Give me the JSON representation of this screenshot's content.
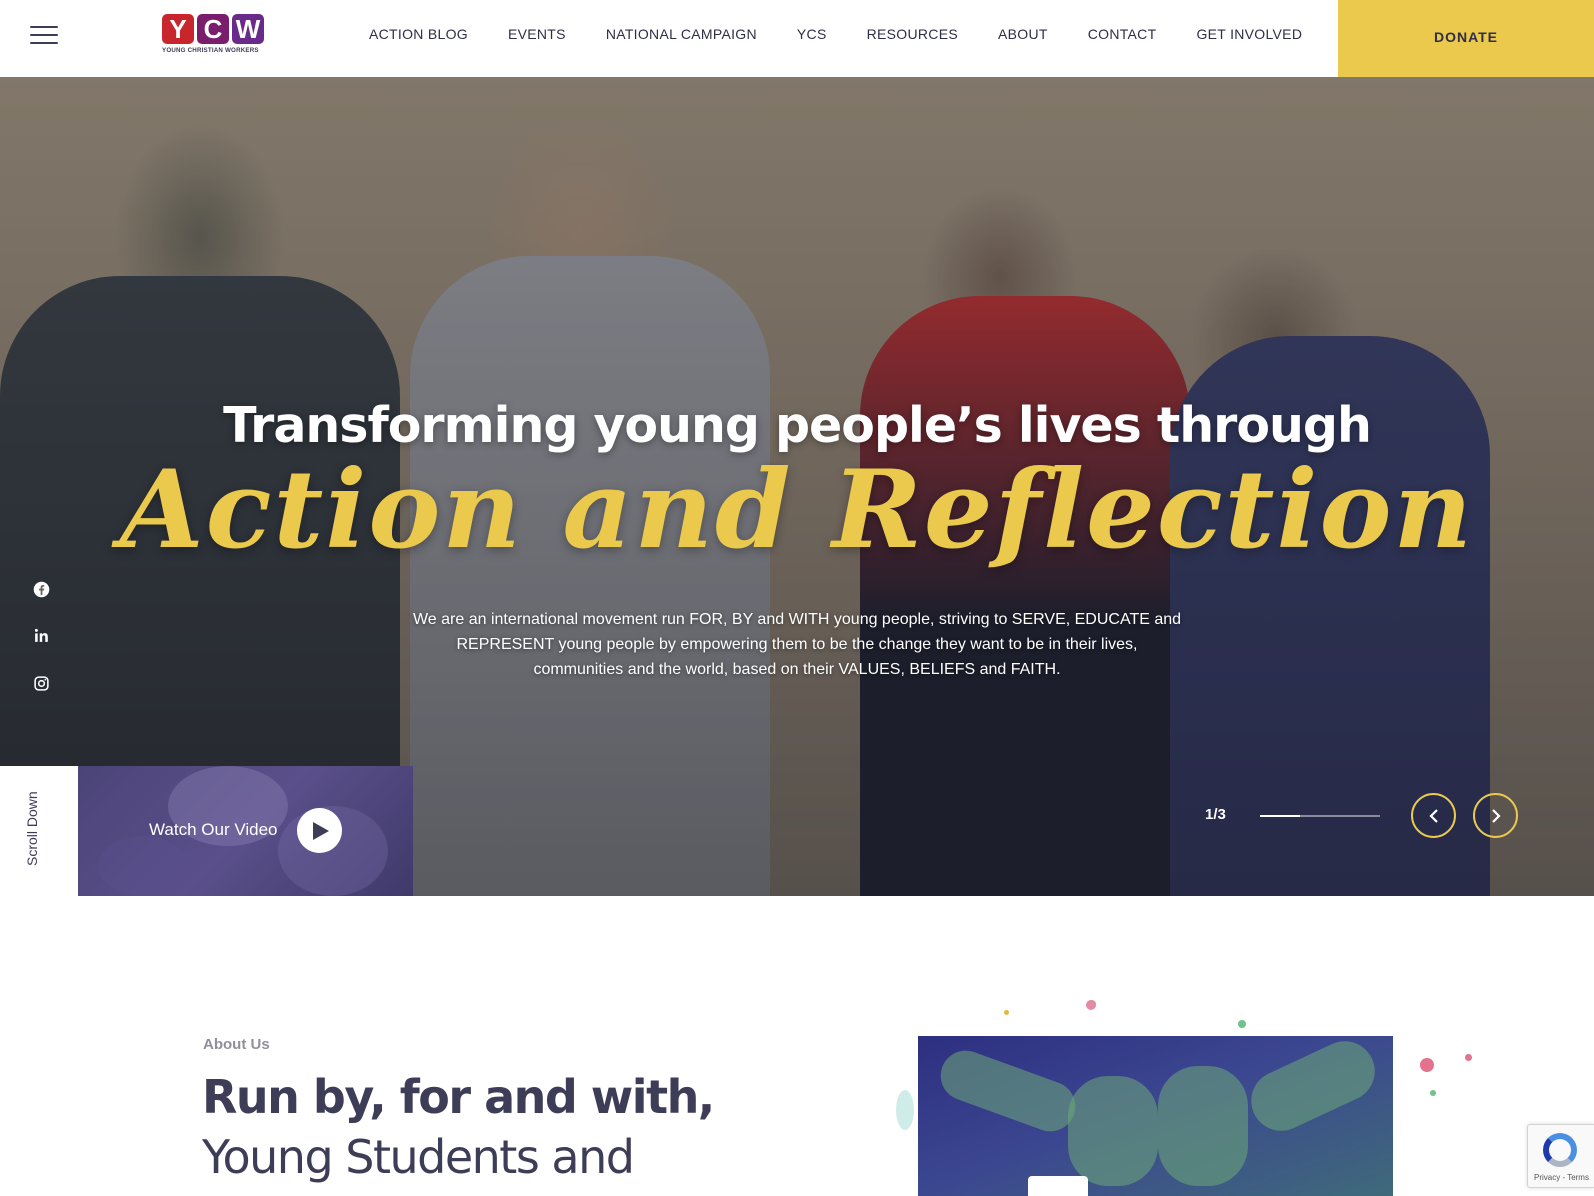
{
  "header": {
    "logo": {
      "letters": [
        "Y",
        "C",
        "W"
      ],
      "subtitle": "YOUNG CHRISTIAN WORKERS"
    },
    "nav": [
      {
        "label": "ACTION BLOG"
      },
      {
        "label": "EVENTS"
      },
      {
        "label": "NATIONAL CAMPAIGN"
      },
      {
        "label": "YCS"
      },
      {
        "label": "RESOURCES"
      },
      {
        "label": "ABOUT"
      },
      {
        "label": "CONTACT"
      },
      {
        "label": "GET INVOLVED"
      }
    ],
    "donate_label": "DONATE",
    "menu_icon": "hamburger-icon"
  },
  "hero": {
    "title_line1": "Transforming young people’s lives through",
    "title_line2": "Action and Reflection",
    "description": "We are an international movement run FOR, BY and WITH young people, striving to SERVE, EDUCATE and REPRESENT young people by empowering them to be the change they want to be in their lives, communities and the world, based on their VALUES, BELIEFS and FAITH.",
    "social": [
      {
        "icon": "facebook-icon"
      },
      {
        "icon": "linkedin-icon"
      },
      {
        "icon": "instagram-icon"
      }
    ],
    "scroll_label": "Scroll Down",
    "video_label": "Watch Our Video",
    "slider": {
      "counter": "1/3",
      "current": 1,
      "total": 3,
      "progress": 0.333
    },
    "accent_color": "#eac94d"
  },
  "about": {
    "eyebrow": "About Us",
    "heading_bold": "Run by, for and with,",
    "heading_light": "Young Students and"
  },
  "recaptcha": {
    "text": "Privacy - Terms"
  }
}
